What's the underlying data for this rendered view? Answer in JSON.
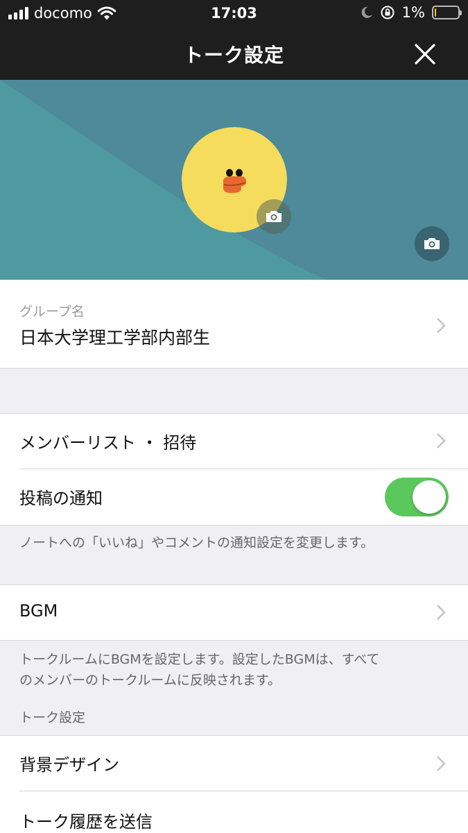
{
  "status_bar": {
    "carrier": "docomo",
    "time": "17:03",
    "battery_percent": "1%",
    "icons": [
      "signal-bars-icon",
      "wifi-icon",
      "moon-icon",
      "rotation-lock-icon",
      "battery-icon"
    ]
  },
  "nav": {
    "title": "トーク設定",
    "close_icon": "close-icon"
  },
  "cover": {
    "avatar_icon": "chick-avatar",
    "camera_icon": "camera-icon",
    "colors": {
      "cover_background": "#4e8a9a",
      "cover_shape": "#4f9aa0",
      "avatar": "#f5dc5c",
      "beak": "#e8672f"
    }
  },
  "group": {
    "caption": "グループ名",
    "name": "日本大学理工学部内部生"
  },
  "rows": {
    "member_list": "メンバーリスト ・ 招待",
    "post_notification": "投稿の通知",
    "post_notification_note": "ノートへの「いいね」やコメントの通知設定を変更します。",
    "bgm": "BGM",
    "bgm_note_line1": "トークルームにBGMを設定します。設定したBGMは、すべて",
    "bgm_note_line2": "のメンバーのトークルームに反映されます。",
    "talk_settings_header": "トーク設定",
    "background_design": "背景デザイン",
    "send_history": "トーク履歴を送信"
  },
  "toggle": {
    "post_notification_on": true,
    "color": "#5ac85c"
  }
}
